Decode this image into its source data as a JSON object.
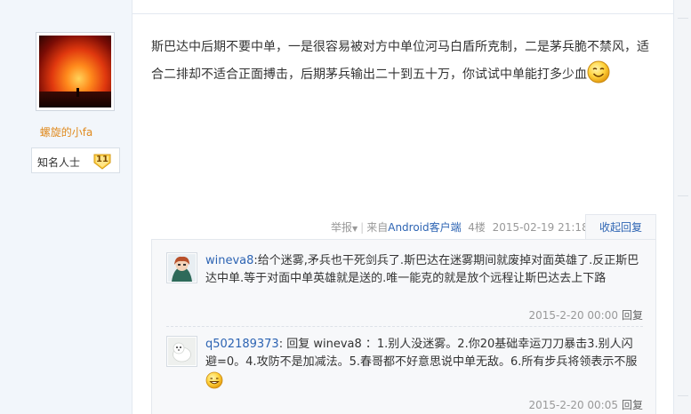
{
  "author": {
    "username": "螺旋的小fa",
    "rank_title": "知名人士",
    "rank_level": "11"
  },
  "post": {
    "text": "斯巴达中后期不要中单，一是很容易被对方中单位河马白盾所克制，二是茅兵脆不禁风，适合二排却不适合正面搏击，后期茅兵输出二十到五十万，你试试中单能打多少血",
    "meta": {
      "report": "举报",
      "source_prefix": "来自",
      "client_link": "Android客户端",
      "floor": "4楼",
      "time": "2015-02-19 21:18"
    },
    "fold_reply_label": "收起回复"
  },
  "replies": [
    {
      "user": "wineva8",
      "text": ":给个迷雾,矛兵也干死剑兵了.斯巴达在迷雾期间就废掉对面英雄了.反正斯巴达中单.等于对面中单英雄就是送的.唯一能克的就是放个远程让斯巴达去上下路",
      "time": "2015-2-20 00:00",
      "reply_label": "回复"
    },
    {
      "user": "q502189373",
      "text": ": 回复 wineva8 ：1.别人没迷雾。2.你20基础幸运刀刀暴击3.别人闪避=0。4.攻防不是加减法。5.春哥都不好意思说中单无敌。6.所有步兵将领表示不服",
      "time": "2015-2-20 00:05",
      "reply_label": "回复"
    }
  ],
  "colors": {
    "link_blue": "#2d64b3",
    "username_orange": "#e08a1e",
    "sidebar_bg": "#f2f6fb"
  }
}
